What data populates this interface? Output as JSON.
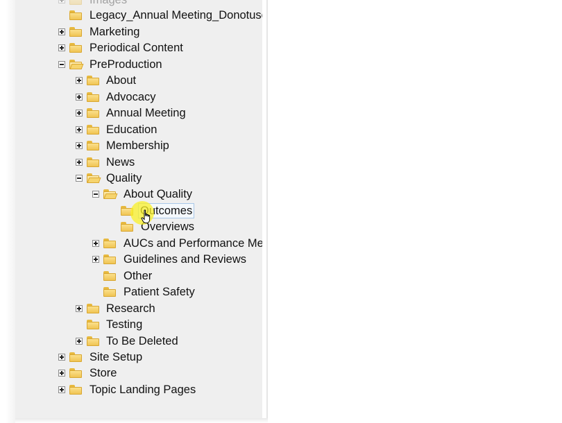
{
  "tree": {
    "nodes": [
      {
        "label": "Images",
        "toggle": "plus",
        "open": false
      },
      {
        "label": "Legacy_Annual Meeting_Donotuse",
        "toggle": "none",
        "open": false
      },
      {
        "label": "Marketing",
        "toggle": "plus",
        "open": false
      },
      {
        "label": "Periodical Content",
        "toggle": "plus",
        "open": false
      },
      {
        "label": "PreProduction",
        "toggle": "minus",
        "open": true
      },
      {
        "label": "About",
        "toggle": "plus",
        "open": false
      },
      {
        "label": "Advocacy",
        "toggle": "plus",
        "open": false
      },
      {
        "label": "Annual Meeting",
        "toggle": "plus",
        "open": false
      },
      {
        "label": "Education",
        "toggle": "plus",
        "open": false
      },
      {
        "label": "Membership",
        "toggle": "plus",
        "open": false
      },
      {
        "label": "News",
        "toggle": "plus",
        "open": false
      },
      {
        "label": "Quality",
        "toggle": "minus",
        "open": true
      },
      {
        "label": "About Quality",
        "toggle": "minus",
        "open": true
      },
      {
        "label": "Outcomes",
        "toggle": "none",
        "open": false,
        "selected": true
      },
      {
        "label": "Overviews",
        "toggle": "none",
        "open": false
      },
      {
        "label": "AUCs and Performance Measures",
        "toggle": "plus",
        "open": false
      },
      {
        "label": "Guidelines and Reviews",
        "toggle": "plus",
        "open": false
      },
      {
        "label": "Other",
        "toggle": "none",
        "open": false
      },
      {
        "label": "Patient Safety",
        "toggle": "none",
        "open": false
      },
      {
        "label": "Research",
        "toggle": "plus",
        "open": false
      },
      {
        "label": "Testing",
        "toggle": "none",
        "open": false
      },
      {
        "label": "To Be Deleted",
        "toggle": "plus",
        "open": false
      },
      {
        "label": "Site Setup",
        "toggle": "plus",
        "open": false
      },
      {
        "label": "Store",
        "toggle": "plus",
        "open": false
      },
      {
        "label": "Topic Landing Pages",
        "toggle": "plus",
        "open": false
      }
    ]
  },
  "icons": {
    "folder": "folder-icon",
    "folder_open": "folder-open-icon",
    "expand": "expand-icon",
    "collapse": "collapse-icon",
    "cursor": "hand-pointer-icon"
  },
  "colors": {
    "panel_bg": "#efefef",
    "folder": "#f0c454",
    "selection_border": "#a9c7e8",
    "cursor_highlight": "#faf028"
  }
}
